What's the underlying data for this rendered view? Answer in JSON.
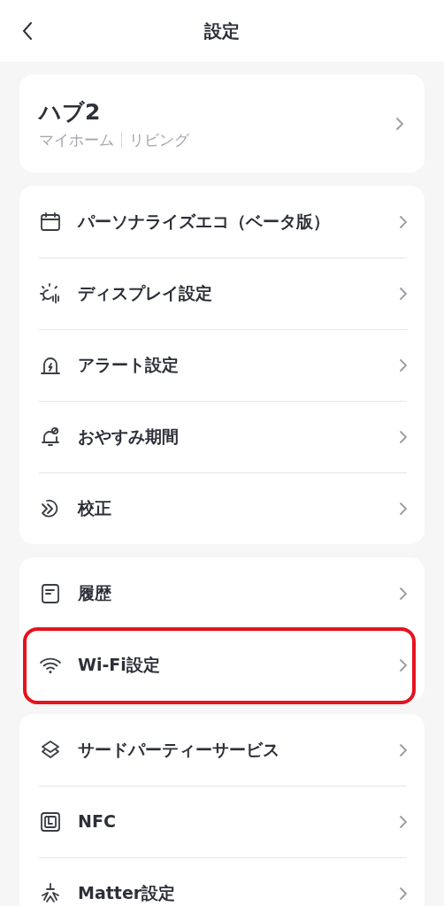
{
  "header": {
    "title": "設定"
  },
  "device": {
    "name": "ハブ2",
    "home": "マイホーム",
    "room": "リビング"
  },
  "groups": [
    {
      "items": [
        {
          "label": "パーソナライズエコ（ベータ版）",
          "highlighted": false
        },
        {
          "label": "ディスプレイ設定",
          "highlighted": false
        },
        {
          "label": "アラート設定",
          "highlighted": false
        },
        {
          "label": "おやすみ期間",
          "highlighted": false
        },
        {
          "label": "校正",
          "highlighted": false
        }
      ]
    },
    {
      "items": [
        {
          "label": "履歴",
          "highlighted": false
        },
        {
          "label": "Wi-Fi設定",
          "highlighted": true
        }
      ]
    },
    {
      "items": [
        {
          "label": "サードパーティーサービス",
          "highlighted": false
        },
        {
          "label": "NFC",
          "highlighted": false
        },
        {
          "label": "Matter設定",
          "highlighted": false
        }
      ]
    }
  ]
}
